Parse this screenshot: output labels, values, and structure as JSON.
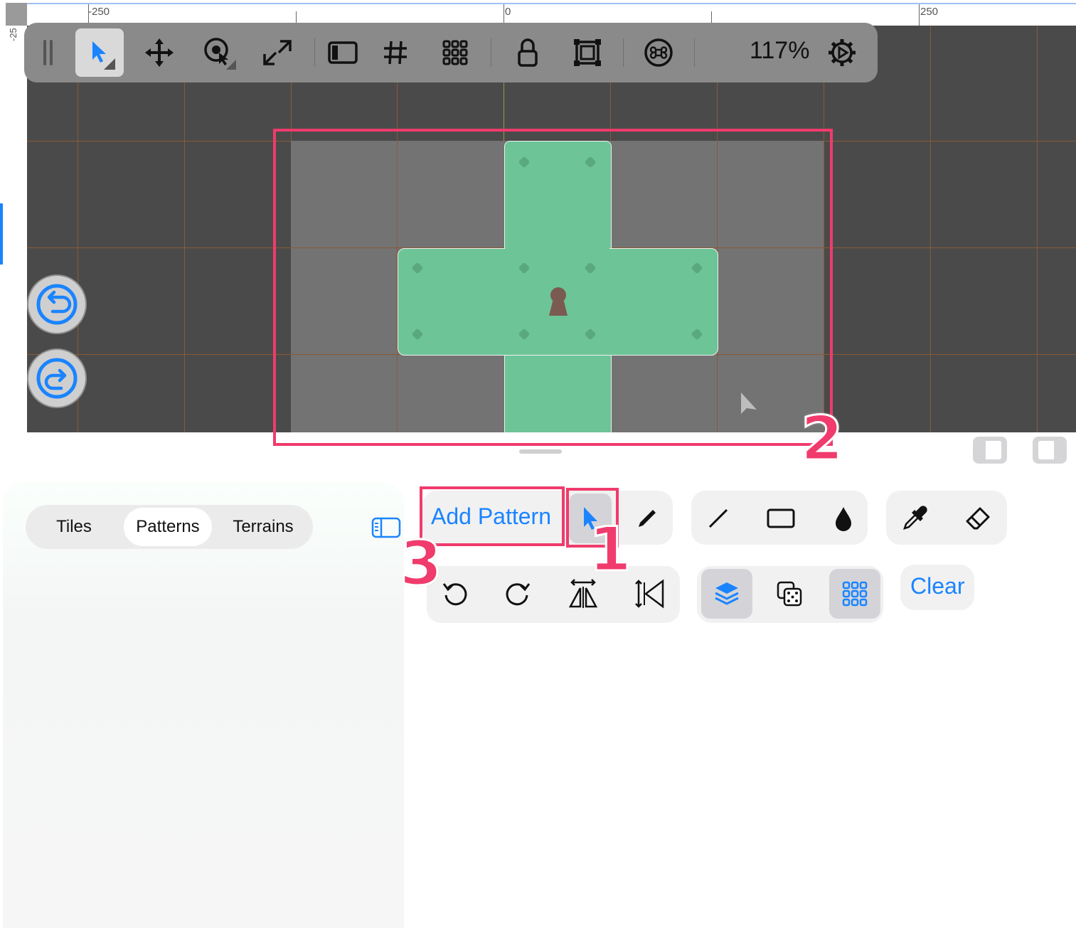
{
  "rulers": {
    "top_labels": [
      "-250",
      "0",
      "250"
    ],
    "left_label": "-25"
  },
  "toolbar": {
    "tools": [
      "drag-handle",
      "select-arrow-icon",
      "move-icon",
      "select-target-icon",
      "resize-arrows-icon",
      "sidebar-icon",
      "grid-hash-icon",
      "tile-grid-icon",
      "lock-icon",
      "frame-icon",
      "command-icon"
    ],
    "zoom": "117%",
    "settings_icon": "gear-icon"
  },
  "history": {
    "undo_icon": "undo-icon",
    "redo_icon": "redo-icon"
  },
  "panel": {
    "tabs": [
      "Tiles",
      "Patterns",
      "Terrains"
    ],
    "active_tab": "Patterns"
  },
  "actions": {
    "add_pattern": "Add Pattern",
    "clear": "Clear"
  },
  "annotations": {
    "one": "1",
    "two": "2",
    "three": "3"
  },
  "colors": {
    "accent": "#1a84ff",
    "highlight": "#f03b6c",
    "tile_green": "#6cc497"
  }
}
